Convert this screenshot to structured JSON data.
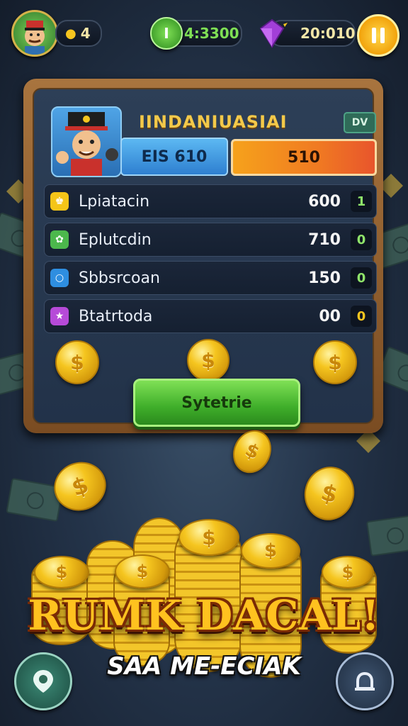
{
  "top_bar": {
    "player_count": "4",
    "cash": "4:3300",
    "gems": "20:010"
  },
  "panel": {
    "title": "IINDANIUASIAI",
    "tag": "DV",
    "stat_left": "EIS 610",
    "stat_right": "510",
    "rows": [
      {
        "label": "Lpiatacin",
        "value": "600",
        "badge": "1",
        "icon_color": "#f5c518",
        "icon": "crown-icon"
      },
      {
        "label": "Eplutcdin",
        "value": "710",
        "badge": "0",
        "icon_color": "#4cb84c",
        "icon": "leaf-icon"
      },
      {
        "label": "Sbbsrcoan",
        "value": "150",
        "badge": "0",
        "icon_color": "#2e8ee0",
        "icon": "drop-icon"
      },
      {
        "label": "Btatrtoda",
        "value": "00",
        "badge": "0",
        "icon_color": "#b64ad8",
        "icon": "star-icon"
      }
    ],
    "claim_label": "Sytetrie"
  },
  "headline": "RUMK DACAL!",
  "subline": "SAA ME-ECIAK",
  "colors": {
    "accent_gold": "#f5c51f",
    "claim_green": "#3fae2a",
    "bar_orange": "#f07a22",
    "bar_blue": "#2e7fd0"
  }
}
